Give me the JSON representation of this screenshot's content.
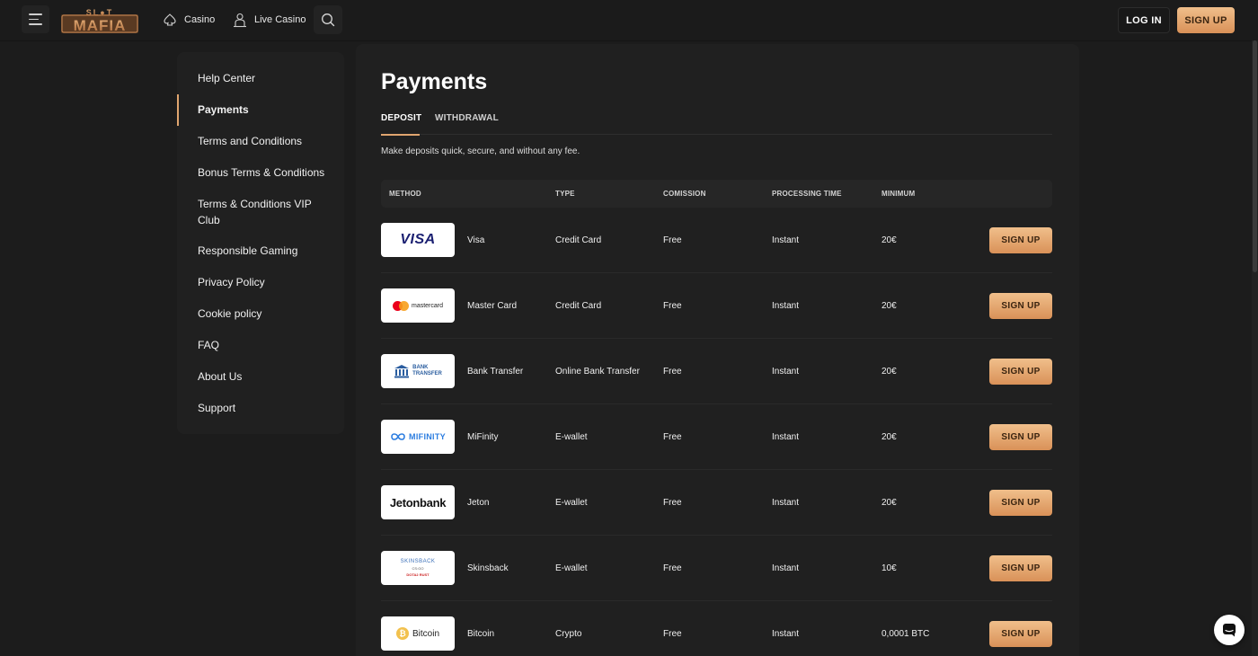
{
  "header": {
    "logo_text": "SLOT MAFIA",
    "nav": [
      {
        "label": "Casino",
        "icon": "spade-icon"
      },
      {
        "label": "Live Casino",
        "icon": "dealer-icon"
      }
    ],
    "login_label": "LOG IN",
    "signup_label": "SIGN UP"
  },
  "sidebar": {
    "items": [
      {
        "label": "Help Center"
      },
      {
        "label": "Payments",
        "active": true
      },
      {
        "label": "Terms and Conditions"
      },
      {
        "label": "Bonus Terms & Conditions"
      },
      {
        "label": "Terms & Conditions VIP Club"
      },
      {
        "label": "Responsible Gaming"
      },
      {
        "label": "Privacy Policy"
      },
      {
        "label": "Cookie policy"
      },
      {
        "label": "FAQ"
      },
      {
        "label": "About Us"
      },
      {
        "label": "Support"
      }
    ]
  },
  "main": {
    "title": "Payments",
    "tabs": [
      {
        "label": "DEPOSIT",
        "active": true
      },
      {
        "label": "WITHDRAWAL"
      }
    ],
    "subtitle": "Make deposits quick, secure, and without any fee.",
    "columns": [
      "METHOD",
      "TYPE",
      "COMISSION",
      "PROCESSING TIME",
      "MINIMUM"
    ],
    "rows": [
      {
        "method": "Visa",
        "type": "Credit Card",
        "commission": "Free",
        "time": "Instant",
        "minimum": "20€",
        "logo": {
          "text": "VISA"
        },
        "button": "SIGN UP"
      },
      {
        "method": "Master Card",
        "type": "Credit Card",
        "commission": "Free",
        "time": "Instant",
        "minimum": "20€",
        "logo": {
          "text": "mastercard"
        },
        "button": "SIGN UP"
      },
      {
        "method": "Bank Transfer",
        "type": "Online Bank Transfer",
        "commission": "Free",
        "time": "Instant",
        "minimum": "20€",
        "logo": {
          "line1": "BANK",
          "line2": "TRANSFER"
        },
        "button": "SIGN UP"
      },
      {
        "method": "MiFinity",
        "type": "E-wallet",
        "commission": "Free",
        "time": "Instant",
        "minimum": "20€",
        "logo": {
          "text": "MIFINITY"
        },
        "button": "SIGN UP"
      },
      {
        "method": "Jeton",
        "type": "E-wallet",
        "commission": "Free",
        "time": "Instant",
        "minimum": "20€",
        "logo": {
          "text": "Jetonbank"
        },
        "button": "SIGN UP"
      },
      {
        "method": "Skinsback",
        "type": "E-wallet",
        "commission": "Free",
        "time": "Instant",
        "minimum": "10€",
        "logo": {
          "line1": "SKINSBACK",
          "line2": "CS:GO",
          "line3": "DOTA2 RUST"
        },
        "button": "SIGN UP"
      },
      {
        "method": "Bitcoin",
        "type": "Crypto",
        "commission": "Free",
        "time": "Instant",
        "minimum": "0,0001 BTC",
        "logo": {
          "text": "Bitcoin",
          "symbol": "₿"
        },
        "button": "SIGN UP"
      }
    ]
  },
  "colors": {
    "accent": "#e0a56f",
    "button_gradient_top": "#f0bf8b",
    "button_gradient_bottom": "#d99158",
    "background": "#1c1c1c",
    "panel": "#202020"
  }
}
